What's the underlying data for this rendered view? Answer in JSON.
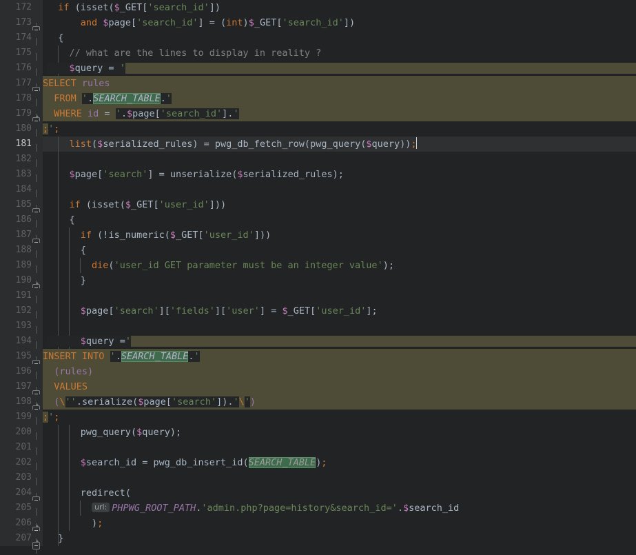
{
  "editor": {
    "theme": "darcula",
    "language": "PHP",
    "colors": {
      "background": "#222324",
      "gutter_background": "#2b2d2e",
      "line_number": "#606366",
      "line_number_active": "#c8cdd2",
      "current_line": "#2f3031",
      "sql_injection_background": "#4e4c37",
      "default_text": "#a9b7c6",
      "keyword": "#cc7832",
      "string": "#6a8759",
      "variable_sigil": "#c77dbb",
      "comment": "#808080",
      "constant": "#9876aa",
      "identifier_highlight_border": "#5a9068",
      "identifier_highlight_fill": "#3d6b4c"
    },
    "caret_line": 181,
    "first_visible_line": 172,
    "last_visible_line": 207,
    "inline_hints": [
      {
        "line": 205,
        "label": "url:"
      }
    ],
    "line_numbers": [
      "172",
      "173",
      "174",
      "175",
      "176",
      "177",
      "178",
      "179",
      "180",
      "181",
      "182",
      "183",
      "184",
      "185",
      "186",
      "187",
      "188",
      "189",
      "190",
      "191",
      "192",
      "193",
      "194",
      "195",
      "196",
      "197",
      "198",
      "199",
      "200",
      "201",
      "202",
      "203",
      "204",
      "205",
      "206",
      "207"
    ],
    "lines": [
      {
        "number": "172",
        "text": "  if (isset($_GET['search_id'])"
      },
      {
        "number": "173",
        "text": "      and $page['search_id'] = (int)$_GET['search_id'])"
      },
      {
        "number": "174",
        "text": "  {"
      },
      {
        "number": "175",
        "text": "    // what are the lines to display in reality ?"
      },
      {
        "number": "176",
        "text": "    $query = '"
      },
      {
        "number": "177",
        "text": "SELECT rules"
      },
      {
        "number": "178",
        "text": "  FROM '.SEARCH_TABLE.'"
      },
      {
        "number": "179",
        "text": "  WHERE id = '.$page['search_id'].'"
      },
      {
        "number": "180",
        "text": ";';"
      },
      {
        "number": "181",
        "text": "    list($serialized_rules) = pwg_db_fetch_row(pwg_query($query));"
      },
      {
        "number": "182",
        "text": ""
      },
      {
        "number": "183",
        "text": "    $page['search'] = unserialize($serialized_rules);"
      },
      {
        "number": "184",
        "text": ""
      },
      {
        "number": "185",
        "text": "    if (isset($_GET['user_id']))"
      },
      {
        "number": "186",
        "text": "    {"
      },
      {
        "number": "187",
        "text": "      if (!is_numeric($_GET['user_id']))"
      },
      {
        "number": "188",
        "text": "      {"
      },
      {
        "number": "189",
        "text": "        die('user_id GET parameter must be an integer value');"
      },
      {
        "number": "190",
        "text": "      }"
      },
      {
        "number": "191",
        "text": ""
      },
      {
        "number": "192",
        "text": "      $page['search']['fields']['user'] = $_GET['user_id'];"
      },
      {
        "number": "193",
        "text": ""
      },
      {
        "number": "194",
        "text": "      $query ='"
      },
      {
        "number": "195",
        "text": "INSERT INTO '.SEARCH_TABLE.'"
      },
      {
        "number": "196",
        "text": "  (rules)"
      },
      {
        "number": "197",
        "text": "  VALUES"
      },
      {
        "number": "198",
        "text": "  (\\''.serialize($page['search']).'\\')"
      },
      {
        "number": "199",
        "text": ";';"
      },
      {
        "number": "200",
        "text": "      pwg_query($query);"
      },
      {
        "number": "201",
        "text": ""
      },
      {
        "number": "202",
        "text": "      $search_id = pwg_db_insert_id(SEARCH_TABLE);"
      },
      {
        "number": "203",
        "text": ""
      },
      {
        "number": "204",
        "text": "      redirect("
      },
      {
        "number": "205",
        "text": "        url: PHPWG_ROOT_PATH.'admin.php?page=history&search_id='.$search_id"
      },
      {
        "number": "206",
        "text": "        );"
      },
      {
        "number": "207",
        "text": "  }"
      }
    ],
    "highlighted_identifier": "SEARCH_TABLE",
    "sql_block_lines": [
      "176",
      "177",
      "178",
      "179",
      "194",
      "195",
      "196",
      "197",
      "198"
    ],
    "fold_markers": [
      {
        "line": "173",
        "type": "expanded-start"
      },
      {
        "line": "177",
        "type": "expanded-start"
      },
      {
        "line": "179",
        "type": "fold-end"
      },
      {
        "line": "185",
        "type": "expanded-start"
      },
      {
        "line": "187",
        "type": "expanded-start"
      },
      {
        "line": "190",
        "type": "fold-end"
      },
      {
        "line": "195",
        "type": "expanded-start"
      },
      {
        "line": "197",
        "type": "expanded-start"
      },
      {
        "line": "198",
        "type": "fold-end"
      },
      {
        "line": "204",
        "type": "expanded-start"
      },
      {
        "line": "206",
        "type": "fold-end"
      },
      {
        "line": "207",
        "type": "fold-end"
      }
    ]
  }
}
